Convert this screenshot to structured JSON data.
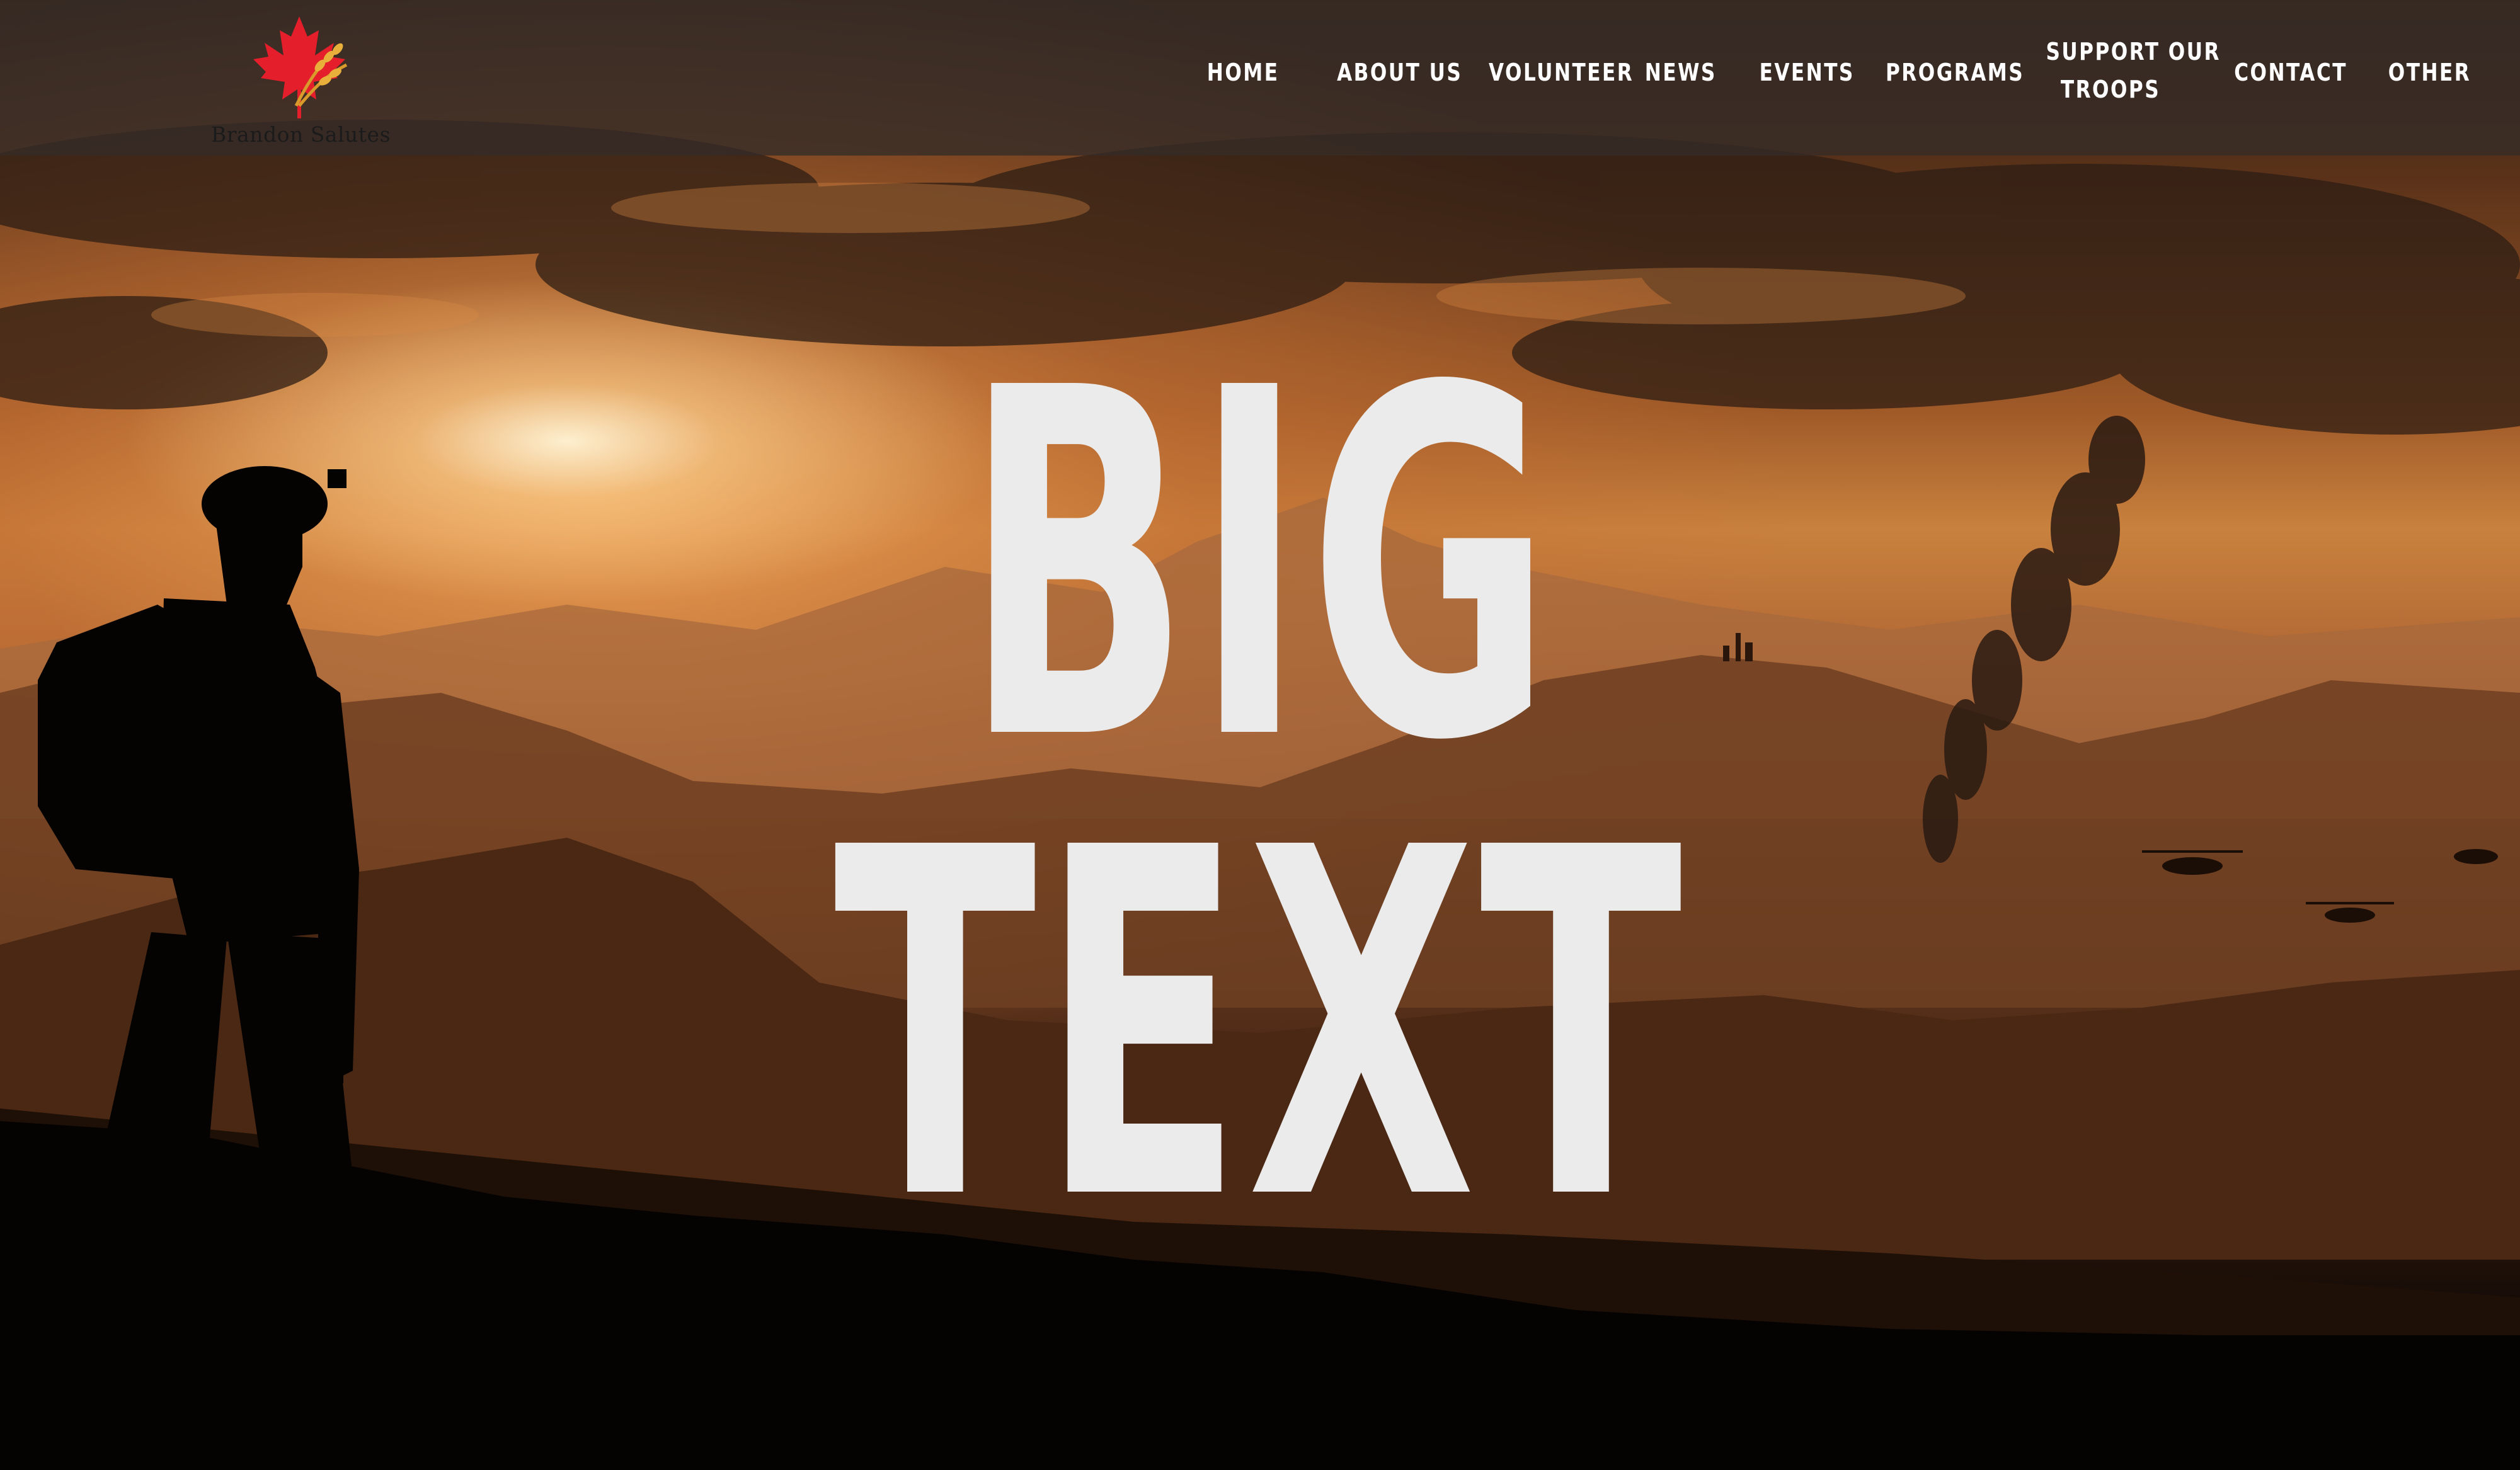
{
  "site": {
    "logo_text": "Brandon Salutes",
    "logo_icon": "maple-leaf-wheat-icon"
  },
  "nav": {
    "items": [
      {
        "label": "HOME"
      },
      {
        "label": "ABOUT US"
      },
      {
        "label": "VOLUNTEER"
      },
      {
        "label": "NEWS"
      },
      {
        "label": "EVENTS"
      },
      {
        "label": "PROGRAMS"
      },
      {
        "label": "SUPPORT OUR",
        "label_line2": "TROOPS"
      },
      {
        "label": "CONTACT"
      },
      {
        "label": "OTHER"
      }
    ]
  },
  "hero": {
    "headline_line1": "BIG",
    "headline_line2": "TEXT",
    "background": "sunset-soldier-silhouette"
  },
  "colors": {
    "nav_bg": "#342c28",
    "nav_text": "#ffffff",
    "headline": "#ebebeb",
    "sky_glow": "#e9a05a",
    "leaf_red": "#e41e2a"
  }
}
